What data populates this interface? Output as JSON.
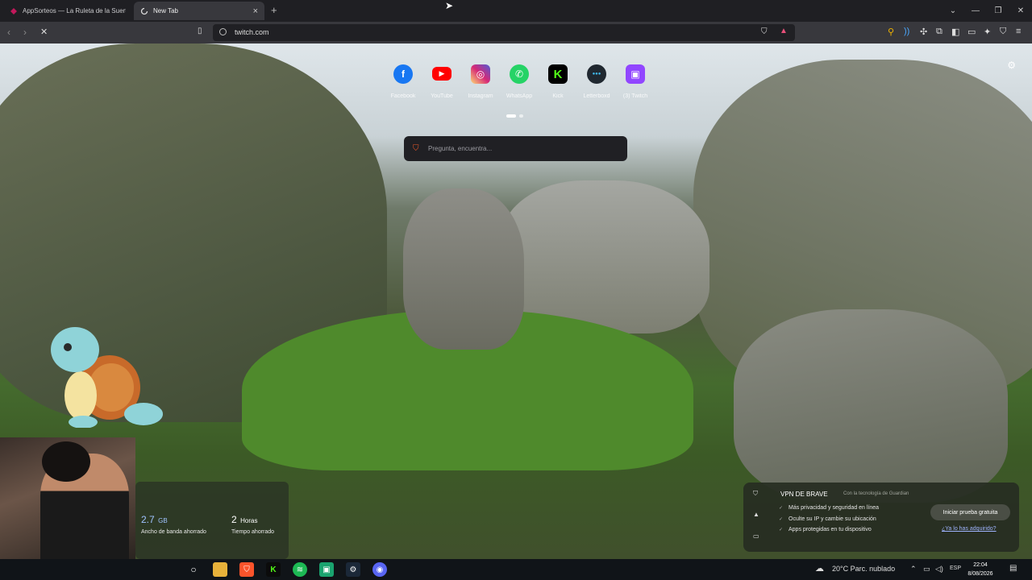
{
  "browser": {
    "tabs": [
      {
        "title": "AppSorteos — La Ruleta de la Suerte",
        "active": false
      },
      {
        "title": "New Tab",
        "active": true
      }
    ],
    "new_tab_symbol": "+",
    "window_controls": [
      "chevron-down-icon",
      "minimize-icon",
      "restore-icon",
      "close-icon"
    ],
    "address": {
      "url": "twitch.com"
    },
    "extensions": [
      "search-extension-icon",
      "audio-extension-icon",
      "puzzle-icon",
      "layout-icon",
      "sidebar-icon",
      "wallet-icon",
      "leo-icon",
      "vpn-icon",
      "menu-icon"
    ]
  },
  "newtab": {
    "top_sites": [
      {
        "label": "Facebook",
        "color": "#1877f2",
        "glyph": "f"
      },
      {
        "label": "YouTube",
        "color": "#ff0000",
        "glyph": "▶"
      },
      {
        "label": "Instagram",
        "color": "#d62976",
        "glyph": "◎"
      },
      {
        "label": "WhatsApp",
        "color": "#25d366",
        "glyph": "✆"
      },
      {
        "label": "Kick",
        "color": "#000000",
        "glyph": "K"
      },
      {
        "label": "Letterboxd",
        "color": "#202830",
        "glyph": "●●●"
      },
      {
        "label": "(3) Twitch",
        "color": "#9146ff",
        "glyph": "▣"
      }
    ],
    "search_placeholder": "Pregunta, encuentra..."
  },
  "stats": {
    "bandwidth_value": "2.7",
    "bandwidth_unit": "GB",
    "bandwidth_label": "Ancho de banda ahorrado",
    "time_value": "2",
    "time_unit": "Horas",
    "time_label": "Tiempo ahorrado"
  },
  "vpn": {
    "title": "VPN DE BRAVE",
    "provider": "Con la tecnología de Guardian",
    "features": [
      "Más privacidad y seguridad en línea",
      "Oculte su IP y cambie su ubicación",
      "Apps protegidas en tu dispositivo"
    ],
    "cta": "Iniciar prueba gratuita",
    "link": "¿Ya lo has adquirido?"
  },
  "taskbar": {
    "weather": "20°C Parc. nublado",
    "lang": "ESP",
    "time": "22:04",
    "date": "8/08/2026"
  }
}
